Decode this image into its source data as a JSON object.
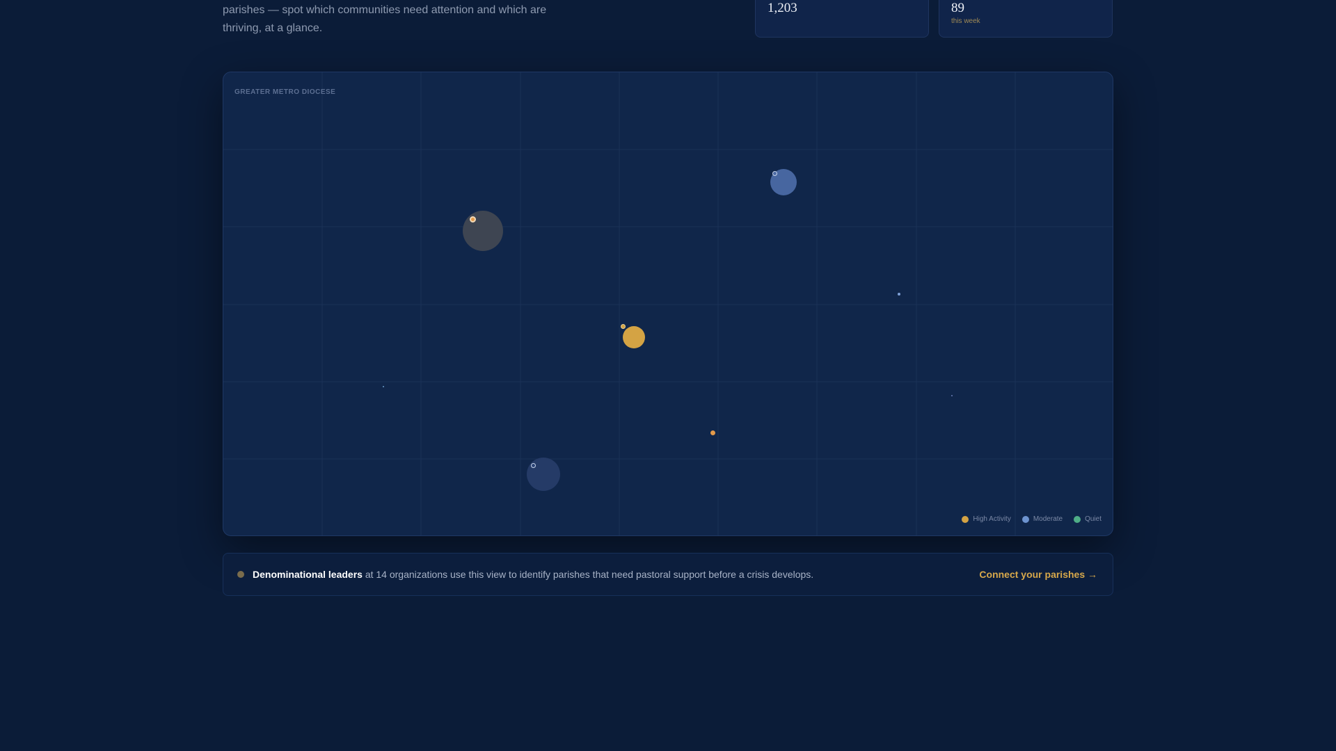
{
  "intro": {
    "line1": "parishes — spot which communities need attention and which are",
    "line2": "thriving, at a glance."
  },
  "stats": [
    {
      "value": "1,203",
      "sub": ""
    },
    {
      "value": "89",
      "sub": "this week"
    }
  ],
  "map": {
    "label": "GREATER METRO DIOCESE",
    "legend": [
      {
        "label": "High Activity",
        "color": "#d4a344"
      },
      {
        "label": "Moderate",
        "color": "#6d93cf"
      },
      {
        "label": "Quiet",
        "color": "#4fae87"
      }
    ]
  },
  "cta": {
    "lead": "Denominational leaders",
    "text": " at 14 organizations use this view to identify parishes that need pastoral support before a crisis develops.",
    "link": "Connect your parishes",
    "arrow": "→"
  }
}
